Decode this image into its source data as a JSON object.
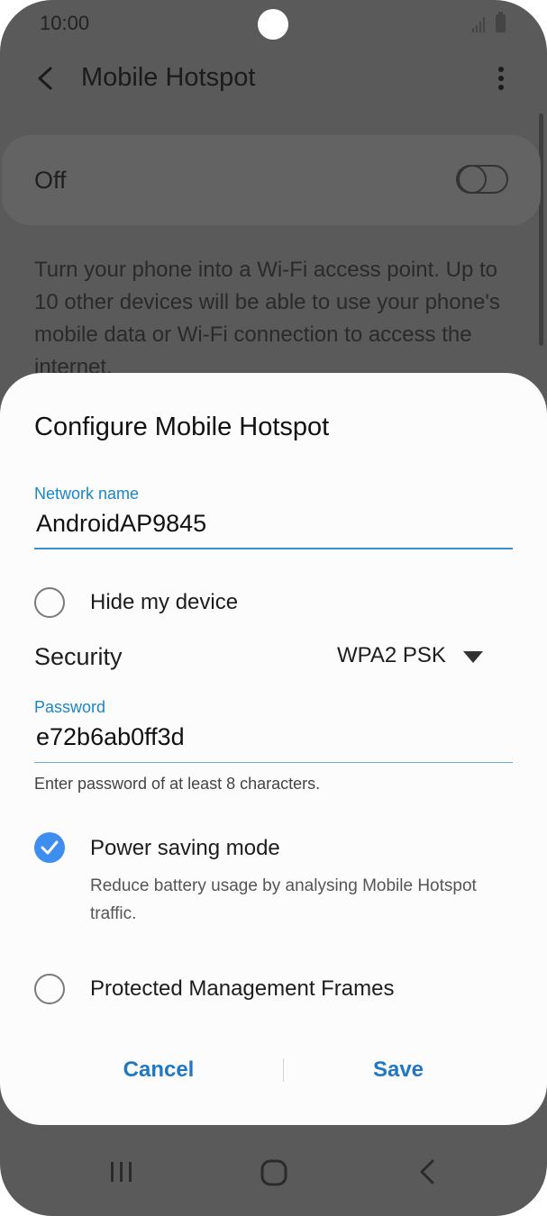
{
  "status_bar": {
    "time": "10:00",
    "icons": [
      "signal-icon",
      "battery-icon"
    ]
  },
  "app_bar": {
    "title": "Mobile Hotspot",
    "back_icon": "chevron-left",
    "more_icon": "vertical-dots"
  },
  "toggle": {
    "label": "Off",
    "state": "off"
  },
  "description": "Turn your phone into a Wi-Fi access point. Up to 10 other devices will be able to use your phone's mobile data or Wi-Fi connection to access the internet.",
  "dialog": {
    "title": "Configure Mobile Hotspot",
    "network_name": {
      "label": "Network name",
      "value": "AndroidAP9845"
    },
    "hide_device": {
      "label": "Hide my device",
      "checked": false
    },
    "security": {
      "label": "Security",
      "value": "WPA2 PSK"
    },
    "password": {
      "label": "Password",
      "value": "e72b6ab0ff3d",
      "helper": "Enter password of at least 8 characters."
    },
    "power_saving": {
      "label": "Power saving mode",
      "description": "Reduce battery usage by analysing Mobile Hotspot traffic.",
      "checked": true
    },
    "pmf": {
      "label": "Protected Management Frames",
      "checked": false
    },
    "buttons": {
      "cancel": "Cancel",
      "save": "Save"
    }
  },
  "nav_bar": {
    "icons": [
      "recents-icon",
      "home-icon",
      "back-icon"
    ]
  },
  "colors": {
    "accent": "#3e8ef0",
    "button_text": "#1f78c4",
    "field_label": "#1a86c8",
    "scrim_bg": "#5a5a5a"
  }
}
